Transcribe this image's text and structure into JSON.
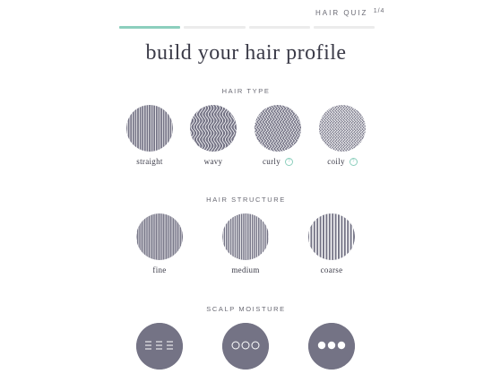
{
  "header": {
    "quiz_label": "HAIR QUIZ",
    "step": "1/4",
    "progress_total": 4,
    "progress_current": 1
  },
  "page_title": "build your hair profile",
  "hair_type": {
    "title": "HAIR TYPE",
    "options": [
      {
        "label": "straight",
        "info": false
      },
      {
        "label": "wavy",
        "info": false
      },
      {
        "label": "curly",
        "info": true
      },
      {
        "label": "coily",
        "info": true
      }
    ]
  },
  "hair_structure": {
    "title": "HAIR STRUCTURE",
    "options": [
      {
        "label": "fine"
      },
      {
        "label": "medium"
      },
      {
        "label": "coarse"
      }
    ]
  },
  "scalp_moisture": {
    "title": "SCALP MOISTURE"
  },
  "colors": {
    "accent": "#8ccfbd",
    "swatch": "#747385",
    "progress_track": "#ececec"
  }
}
